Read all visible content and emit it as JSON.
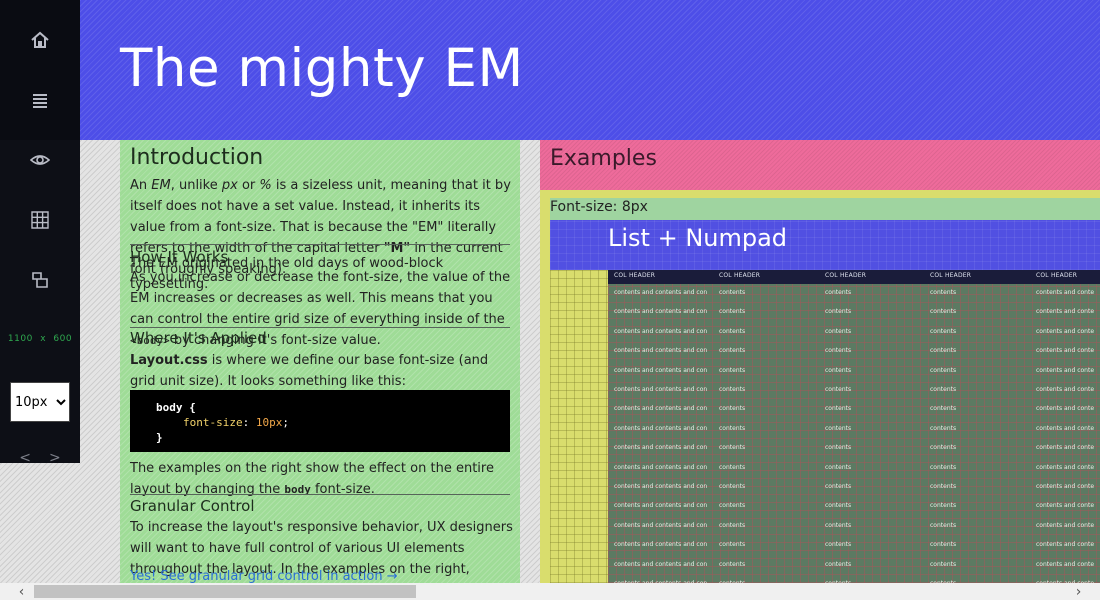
{
  "sidebar": {
    "buttons": [
      "home-icon",
      "menu-icon",
      "eye-icon",
      "grid-icon",
      "layers-icon"
    ],
    "viewport_w": "1100",
    "viewport_x": "x",
    "viewport_h": "600",
    "font_size_select": "10px",
    "prev": "<",
    "next": ">"
  },
  "header": {
    "title": "The mighty EM"
  },
  "intro": {
    "title": "Introduction",
    "p1_a": "An ",
    "p1_em": "EM",
    "p1_b": ", unlike ",
    "p1_px": "px",
    "p1_c": " or ",
    "p1_pct": "%",
    "p1_d": " is a sizeless unit, meaning that it by itself does not have a set value. Instead, it inherits its value from a font-size. That is because the \"EM\" literally refers to the width of the capital letter ",
    "p1_m": "\"M\"",
    "p1_e": " in the current font (roughly speaking).",
    "p2": "The EM originated in the old days of wood-block typesetting.",
    "how_title": "How It Works",
    "p3_a": "As you increase or decrease the font-size, the value of the EM increases or decreases as well. This means that you can control the entire grid size of everything inside of the ",
    "p3_code": "<body>",
    "p3_b": " by changing it's font-size value.",
    "where_title": "Where It's Applied",
    "p4_a": "Layout.css",
    "p4_b": " is where we define our base font-size (and grid unit size). It looks something like this:",
    "code_line1": "body {",
    "code_prop": "font-size",
    "code_val": "10px",
    "code_end": "}",
    "p5_a": "The examples on the right show the effect on the entire layout by changing the ",
    "p5_code": "body",
    "p5_b": " font-size.",
    "granular_title": "Granular Control",
    "p6": "To increase the layout's responsive behavior, UX designers will want to have full control of various UI elements throughout the layout. In the examples on the right, everything scales. But say",
    "link": "Yes! See granular grid control in action →"
  },
  "examples": {
    "title": "Examples",
    "font_size_label": "Font-size: 8px",
    "list_title": "List + Numpad",
    "columns": [
      "COL HEADER",
      "COL HEADER",
      "COL HEADER",
      "COL HEADER",
      "COL HEADER"
    ],
    "row_cells": [
      "contents and contents and con",
      "contents",
      "contents",
      "contents",
      "contents and conte"
    ],
    "row_count": 16
  },
  "scrollbar": {
    "left": "‹",
    "right": "›"
  }
}
